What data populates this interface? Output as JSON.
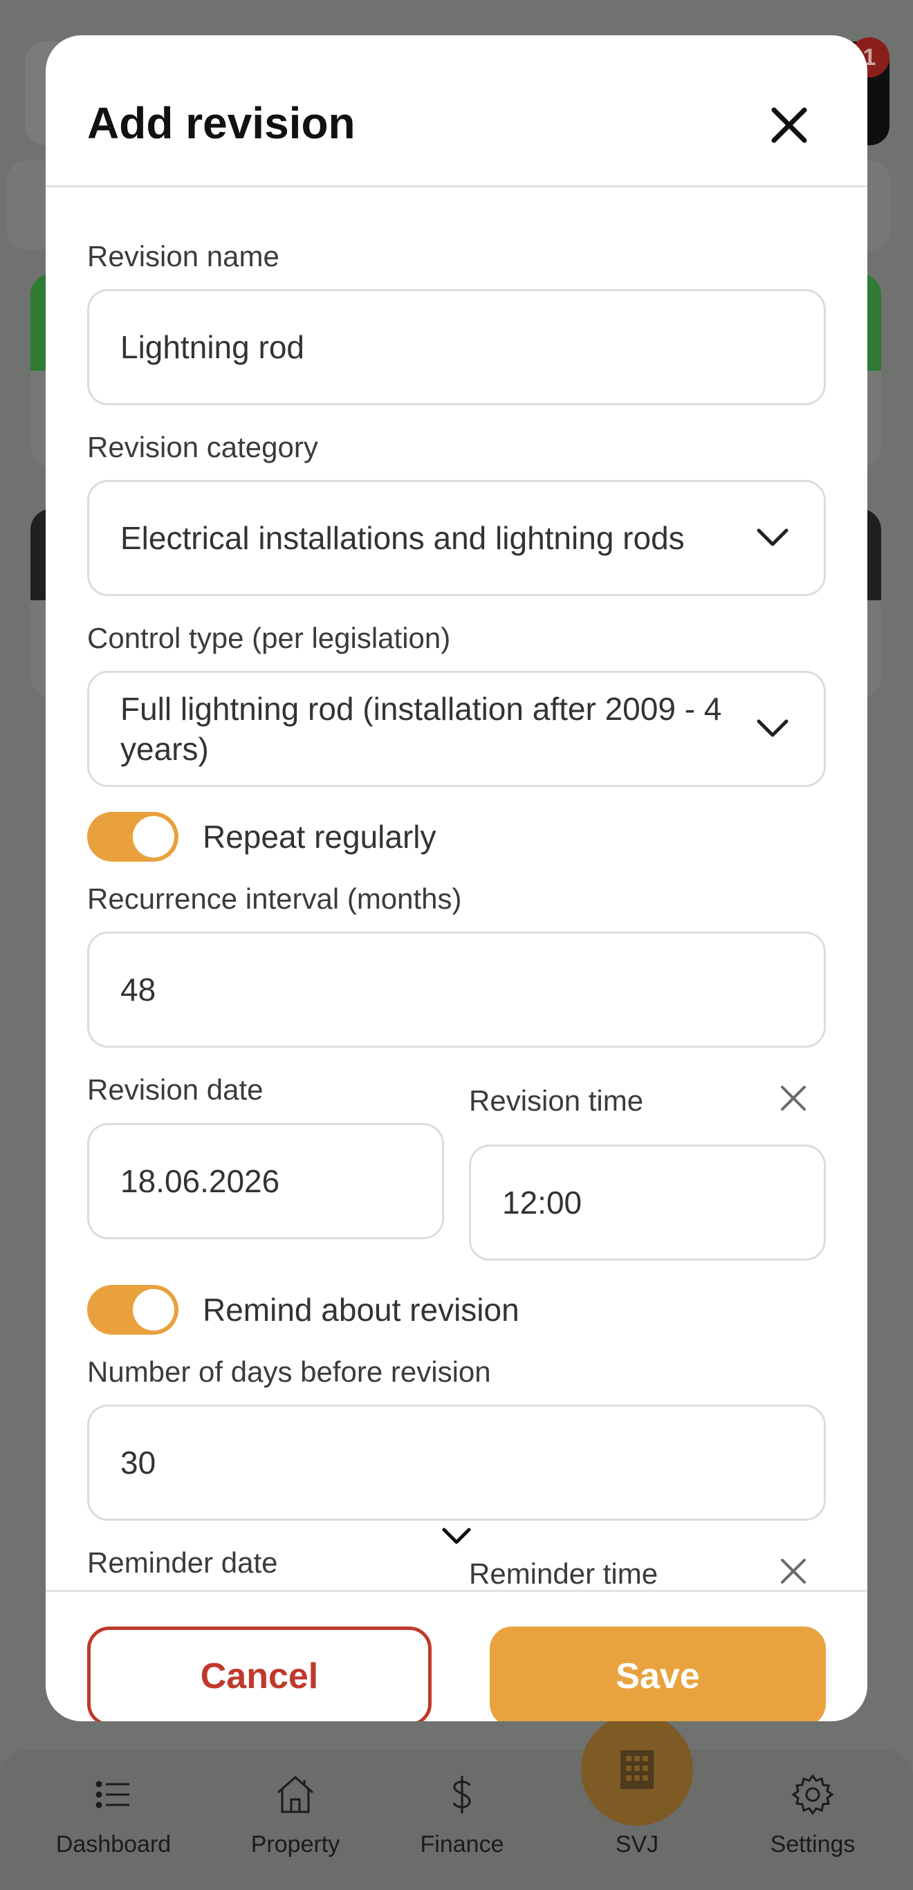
{
  "background": {
    "notification_badge": "1"
  },
  "bottom_nav": {
    "items": [
      {
        "label": "Dashboard",
        "icon": "list-icon"
      },
      {
        "label": "Property",
        "icon": "home-icon"
      },
      {
        "label": "Finance",
        "icon": "dollar-icon"
      },
      {
        "label": "SVJ",
        "icon": "building-icon"
      },
      {
        "label": "Settings",
        "icon": "gear-icon"
      }
    ]
  },
  "modal": {
    "title": "Add revision",
    "fields": {
      "revision_name": {
        "label": "Revision name",
        "value": "Lightning rod"
      },
      "revision_category": {
        "label": "Revision category",
        "value": "Electrical installations and lightning rods"
      },
      "control_type": {
        "label": "Control type (per legislation)",
        "value": "Full lightning rod (installation after 2009 - 4 years)"
      },
      "repeat_regularly": {
        "label": "Repeat regularly",
        "on": true
      },
      "recurrence_interval": {
        "label": "Recurrence interval (months)",
        "value": "48"
      },
      "revision_date": {
        "label": "Revision date",
        "value": "18.06.2026"
      },
      "revision_time": {
        "label": "Revision time",
        "value": "12:00"
      },
      "remind_about_revision": {
        "label": "Remind about revision",
        "on": true
      },
      "days_before": {
        "label": "Number of days before revision",
        "value": "30"
      },
      "reminder_date": {
        "label": "Reminder date"
      },
      "reminder_time": {
        "label": "Reminder time"
      }
    },
    "footer": {
      "cancel_label": "Cancel",
      "save_label": "Save"
    }
  },
  "colors": {
    "accent": "#e8a33f",
    "danger": "#c0392b"
  }
}
